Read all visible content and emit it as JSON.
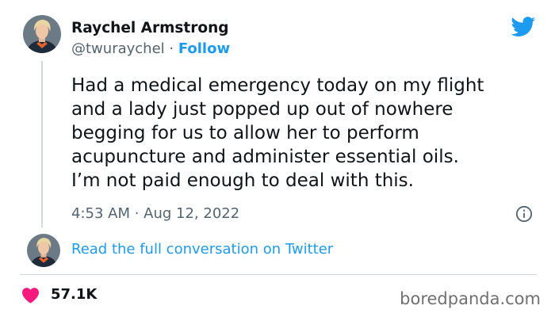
{
  "author": {
    "name": "Raychel Armstrong",
    "handle": "@twuraychel",
    "separator": " · ",
    "follow_label": "Follow"
  },
  "tweet": {
    "lines": [
      "Had a medical emergency today on my flight",
      "and a lady just popped up out of nowhere",
      "begging for us to allow her to perform",
      "acupuncture and administer essential oils.",
      "I’m not paid enough to deal with this."
    ],
    "timestamp": "4:53 AM · Aug 12, 2022"
  },
  "thread": {
    "read_more_label": "Read the full conversation on Twitter"
  },
  "engagement": {
    "likes": "57.1K"
  },
  "watermark": "boredpanda.com",
  "icons": {
    "brand": "twitter-bird-icon",
    "info": "info-icon",
    "like": "heart-icon"
  },
  "colors": {
    "accent": "#1d9bf0",
    "like": "#f91880",
    "text": "#0f1419",
    "muted": "#536471"
  }
}
